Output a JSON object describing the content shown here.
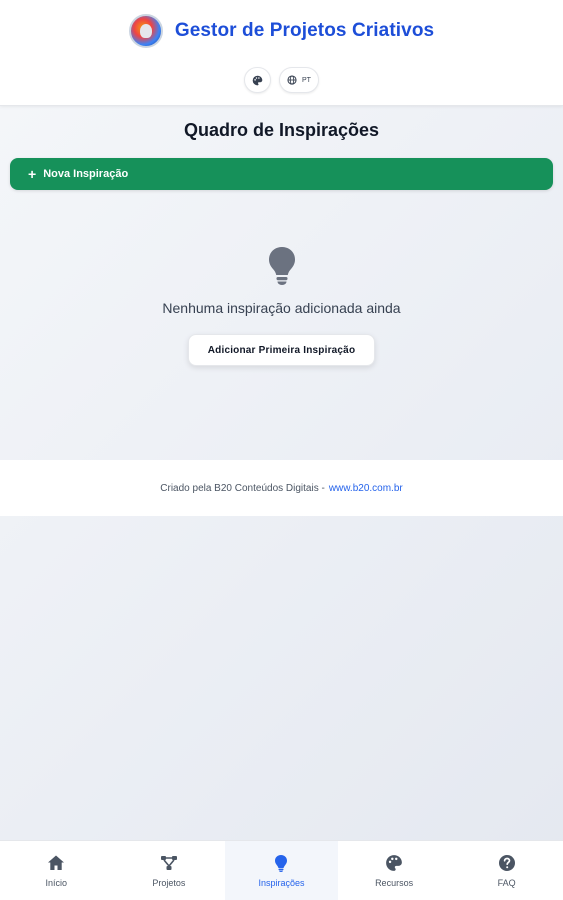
{
  "app": {
    "title": "Gestor de Projetos Criativos",
    "lang_label": "PT"
  },
  "main": {
    "title": "Quadro de Inspirações",
    "new_button": "Nova Inspiração",
    "empty_text": "Nenhuma inspiração adicionada ainda",
    "first_button": "Adicionar Primeira Inspiração"
  },
  "footer": {
    "text": "Criado pela B20 Conteúdos Digitais -",
    "link": "www.b20.com.br"
  },
  "nav": {
    "items": [
      {
        "label": "Início",
        "icon": "home-icon"
      },
      {
        "label": "Projetos",
        "icon": "projects-icon"
      },
      {
        "label": "Inspirações",
        "icon": "lightbulb-icon",
        "active": true
      },
      {
        "label": "Recursos",
        "icon": "palette-icon"
      },
      {
        "label": "FAQ",
        "icon": "question-icon"
      }
    ]
  },
  "colors": {
    "accent": "#1d4ed8",
    "primary_button": "#16915a",
    "active_nav": "#2563eb"
  }
}
